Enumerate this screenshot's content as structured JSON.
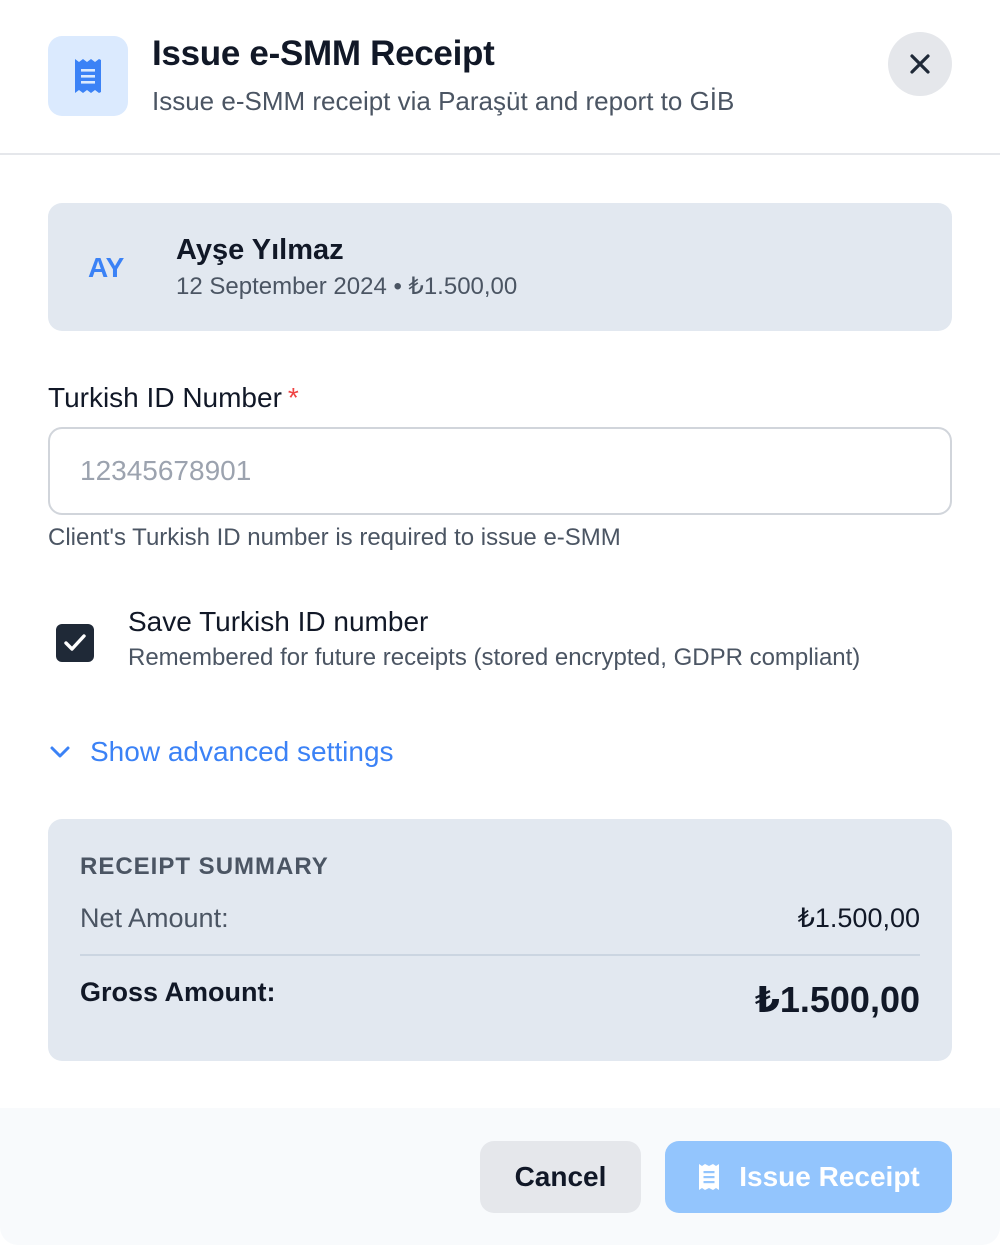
{
  "header": {
    "title": "Issue e-SMM Receipt",
    "subtitle": "Issue e-SMM receipt via Paraşüt and report to GİB",
    "icon": "receipt-icon",
    "close_icon": "close-icon"
  },
  "client": {
    "initials": "AY",
    "name": "Ayşe Yılmaz",
    "meta": "12 September 2024 • ₺1.500,00"
  },
  "id_field": {
    "label": "Turkish ID Number",
    "required_mark": "*",
    "placeholder": "12345678901",
    "value": "",
    "helper": "Client's Turkish ID number is required to issue e-SMM"
  },
  "save_id": {
    "checked": true,
    "title": "Save Turkish ID number",
    "description": "Remembered for future receipts (stored encrypted, GDPR compliant)"
  },
  "advanced": {
    "label": "Show advanced settings",
    "icon": "chevron-down-icon"
  },
  "summary": {
    "heading": "RECEIPT SUMMARY",
    "net_label": "Net Amount:",
    "net_value": "₺1.500,00",
    "gross_label": "Gross Amount:",
    "gross_value": "₺1.500,00"
  },
  "footer": {
    "cancel_label": "Cancel",
    "issue_label": "Issue Receipt",
    "issue_icon": "receipt-icon"
  },
  "colors": {
    "accent": "#3b82f6",
    "accent_light": "#dbeafe",
    "primary_disabled": "#93c5fd",
    "card_bg": "#e2e8f0",
    "required": "#ef4444"
  }
}
